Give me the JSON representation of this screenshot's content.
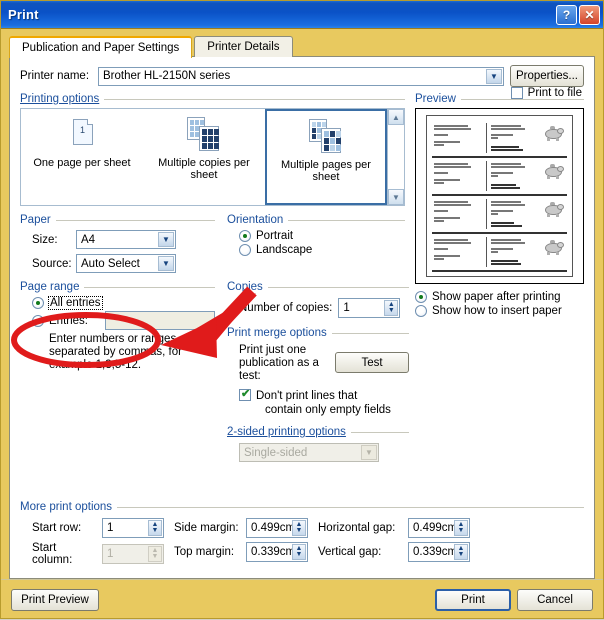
{
  "window": {
    "title": "Print",
    "help_button": "?",
    "close_button": "✕"
  },
  "tabs": [
    {
      "label": "Publication and Paper Settings",
      "active": true
    },
    {
      "label": "Printer Details",
      "active": false
    }
  ],
  "printer": {
    "label": "Printer name:",
    "value": "Brother HL-2150N series",
    "properties_button": "Properties...",
    "print_to_file_label": "Print to file",
    "print_to_file_checked": false
  },
  "printing_options": {
    "group_title": "Printing options",
    "items": [
      {
        "label": "One page per sheet",
        "selected": false
      },
      {
        "label": "Multiple copies per sheet",
        "selected": false
      },
      {
        "label": "Multiple pages per sheet",
        "selected": true
      }
    ]
  },
  "preview": {
    "group_title": "Preview",
    "show_paper_label": "Show paper after printing",
    "show_insert_label": "Show how to insert paper",
    "show_paper_selected": true,
    "show_insert_selected": false
  },
  "paper": {
    "group_title": "Paper",
    "size_label": "Size:",
    "size_value": "A4",
    "source_label": "Source:",
    "source_value": "Auto Select"
  },
  "orientation": {
    "group_title": "Orientation",
    "portrait_label": "Portrait",
    "landscape_label": "Landscape",
    "portrait_selected": true,
    "landscape_selected": false
  },
  "page_range": {
    "group_title": "Page range",
    "all_entries_label": "All entries",
    "entries_label": "Entries:",
    "entries_value": "",
    "all_entries_selected": true,
    "entries_selected": false,
    "hint_line1": "Enter numbers or ranges",
    "hint_line2": "separated by commas, for",
    "hint_line3": "example 1,3,5-12."
  },
  "copies": {
    "group_title": "Copies",
    "number_label": "Number of copies:",
    "number_value": "1"
  },
  "print_merge": {
    "group_title": "Print merge options",
    "test_text_line1": "Print just one",
    "test_text_line2": "publication as a",
    "test_text_line3": "test:",
    "test_button": "Test",
    "dont_print_line1": "Don't print lines that",
    "dont_print_line2": "contain only empty fields",
    "dont_print_checked": true
  },
  "two_sided": {
    "group_title": "2-sided printing options",
    "value": "Single-sided",
    "disabled": true
  },
  "more_options": {
    "group_title": "More print options",
    "start_row_label": "Start row:",
    "start_row_value": "1",
    "start_column_label": "Start column:",
    "start_column_value": "1",
    "start_column_disabled": true,
    "side_margin_label": "Side margin:",
    "side_margin_value": "0.499cm",
    "top_margin_label": "Top margin:",
    "top_margin_value": "0.339cm",
    "horizontal_gap_label": "Horizontal gap:",
    "horizontal_gap_value": "0.499cm",
    "vertical_gap_label": "Vertical gap:",
    "vertical_gap_value": "0.339cm"
  },
  "footer": {
    "print_preview_button": "Print Preview",
    "print_button": "Print",
    "cancel_button": "Cancel"
  },
  "annotation": {
    "ellipse_color": "#e01b1b",
    "arrow_color": "#e01b1b"
  },
  "colors": {
    "titlebar_blue": "#0a52c7",
    "frame_gold": "#e8c95f",
    "group_label_blue": "#1b4f9c",
    "selection_blue": "#3a6ea5"
  }
}
